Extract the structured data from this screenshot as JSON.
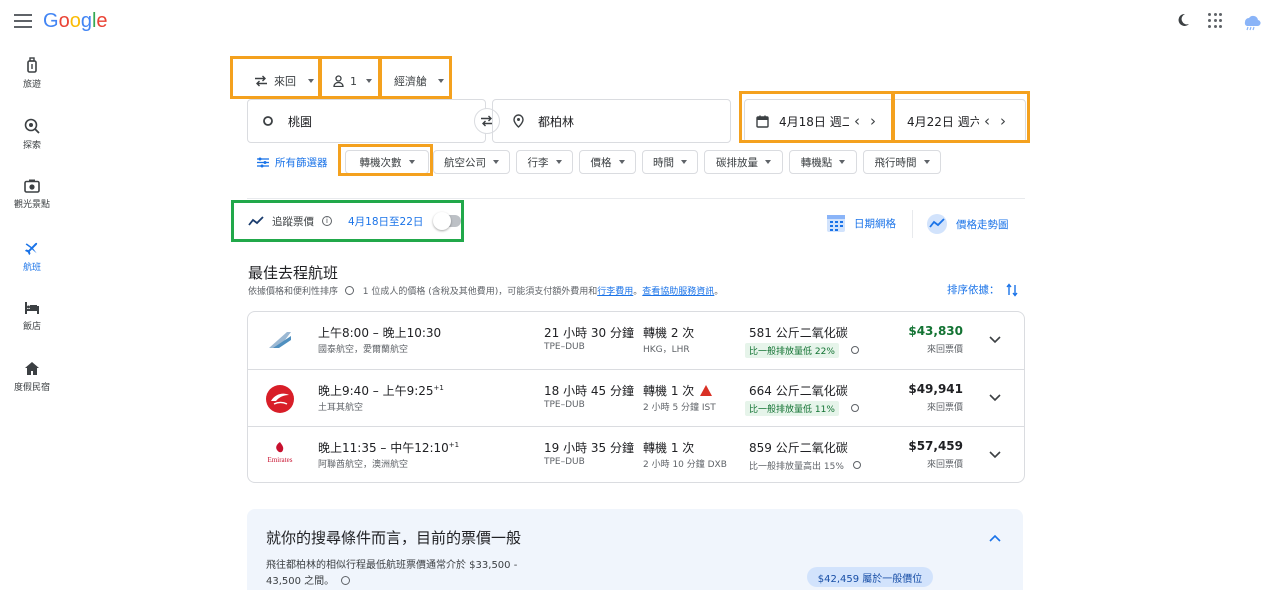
{
  "app": {
    "logo": "Google",
    "colors": {
      "accent": "#1a73e8",
      "highlight_orange": "#f4a11e",
      "highlight_green": "#21a84a",
      "price_low": "#137333"
    }
  },
  "sidebar": {
    "items": [
      {
        "label": "旅遊",
        "icon": "luggage-icon"
      },
      {
        "label": "探索",
        "icon": "explore-icon"
      },
      {
        "label": "觀光景點",
        "icon": "camera-icon"
      },
      {
        "label": "航班",
        "icon": "flight-icon",
        "active": true
      },
      {
        "label": "飯店",
        "icon": "hotel-icon"
      },
      {
        "label": "度假民宿",
        "icon": "home-icon"
      }
    ]
  },
  "search": {
    "trip_type": "來回",
    "passengers": "1",
    "cabin_class": "經濟艙",
    "origin": "桃園",
    "destination": "都柏林",
    "depart_date": "4月18日 週二",
    "return_date": "4月22日 週六"
  },
  "filters": {
    "all_filters": "所有篩選器",
    "chips": [
      "轉機次數",
      "航空公司",
      "行李",
      "價格",
      "時間",
      "碳排放量",
      "轉機點",
      "飛行時間"
    ]
  },
  "tracking": {
    "label": "追蹤票價",
    "dates": "4月18日至22日",
    "date_grid": "日期網格",
    "price_graph": "價格走勢圖"
  },
  "results": {
    "title": "最佳去程航班",
    "subtitle_a": "依據價格和便利性排序",
    "subtitle_b": "1 位成人的價格 (含稅及其他費用)，可能須支付額外費用和",
    "subtitle_link1": "行李費用",
    "subtitle_c": "。",
    "subtitle_link2": "查看協助服務資訊",
    "subtitle_d": "。",
    "sort_label": "排序依據：",
    "flights": [
      {
        "times": "上午8:00 – 晚上10:30",
        "plus": "",
        "airline": "國泰航空，愛爾蘭航空",
        "duration": "21 小時 30 分鐘",
        "route": "TPE–DUB",
        "stops": "轉機 2 次",
        "stops_detail": "HKG，LHR",
        "warning": false,
        "emissions": "581 公斤二氧化碳",
        "emissions_note": "比一般排放量低 22%",
        "emissions_green": true,
        "price": "$43,830",
        "price_green": true,
        "price_note": "來回票價"
      },
      {
        "times": "晚上9:40 – 上午9:25",
        "plus": "+1",
        "airline": "土耳其航空",
        "duration": "18 小時 45 分鐘",
        "route": "TPE–DUB",
        "stops": "轉機 1 次",
        "stops_detail": "2 小時 5 分鐘 IST",
        "warning": true,
        "emissions": "664 公斤二氧化碳",
        "emissions_note": "比一般排放量低 11%",
        "emissions_green": true,
        "price": "$49,941",
        "price_green": false,
        "price_note": "來回票價"
      },
      {
        "times": "晚上11:35 – 中午12:10",
        "plus": "+1",
        "airline": "阿聯酋航空，澳洲航空",
        "duration": "19 小時 35 分鐘",
        "route": "TPE–DUB",
        "stops": "轉機 1 次",
        "stops_detail": "2 小時 10 分鐘 DXB",
        "warning": false,
        "emissions": "859 公斤二氧化碳",
        "emissions_note": "比一般排放量高出 15%",
        "emissions_green": false,
        "price": "$57,459",
        "price_green": false,
        "price_note": "來回票價",
        "logo_text": "Emirates"
      }
    ]
  },
  "insight": {
    "title": "就你的搜尋條件而言，目前的票價一般",
    "text": "飛往都柏林的相似行程最低航班票價通常介於 $33,500 - 43,500 之間。",
    "price_pill": "$42,459 屬於一般價位"
  }
}
